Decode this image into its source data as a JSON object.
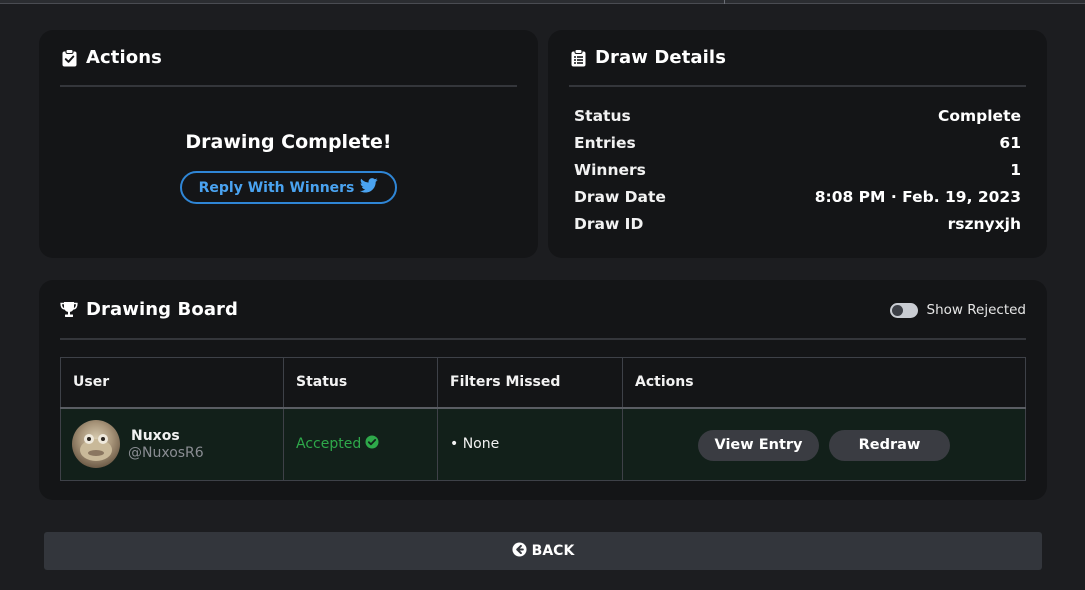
{
  "actions": {
    "title": "Actions",
    "heading": "Drawing Complete!",
    "reply_label": "Reply With Winners",
    "icon": "clipboard-check-icon"
  },
  "details": {
    "title": "Draw Details",
    "icon": "clipboard-list-icon",
    "rows": [
      {
        "label": "Status",
        "value": "Complete"
      },
      {
        "label": "Entries",
        "value": "61"
      },
      {
        "label": "Winners",
        "value": "1"
      },
      {
        "label": "Draw Date",
        "value": "8:08 PM · Feb. 19, 2023"
      },
      {
        "label": "Draw ID",
        "value": "rsznyxjh"
      }
    ]
  },
  "board": {
    "title": "Drawing Board",
    "icon": "trophy-icon",
    "toggle_label": "Show Rejected",
    "toggle_on": false,
    "columns": [
      "User",
      "Status",
      "Filters Missed",
      "Actions"
    ],
    "rows": [
      {
        "name": "Nuxos",
        "handle": "@NuxosR6",
        "status": "Accepted",
        "filters": "• None",
        "view_label": "View Entry",
        "redraw_label": "Redraw"
      }
    ]
  },
  "back_label": "BACK",
  "colors": {
    "accent_blue": "#2f86d6",
    "accepted_green": "#2ea84a",
    "card_bg": "#141517",
    "page_bg": "#1c1d20"
  }
}
